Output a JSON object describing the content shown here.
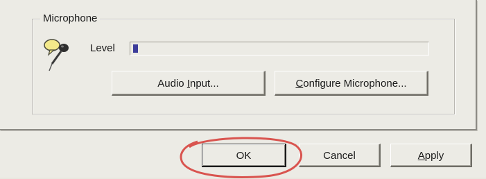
{
  "microphone_group": {
    "title": "Microphone",
    "level_label": "Level",
    "level_value": 0.02
  },
  "buttons": {
    "audio_input": {
      "prefix": "Audio ",
      "accel": "I",
      "suffix": "nput..."
    },
    "configure_microphone": {
      "prefix": "",
      "accel": "C",
      "suffix": "onfigure Microphone..."
    },
    "ok": "OK",
    "cancel": "Cancel",
    "apply": {
      "prefix": "",
      "accel": "A",
      "suffix": "pply"
    }
  },
  "icons": {
    "microphone": "microphone-speech-icon"
  },
  "colors": {
    "level_fill": "#3c3c9a",
    "highlight": "#d9544f"
  }
}
